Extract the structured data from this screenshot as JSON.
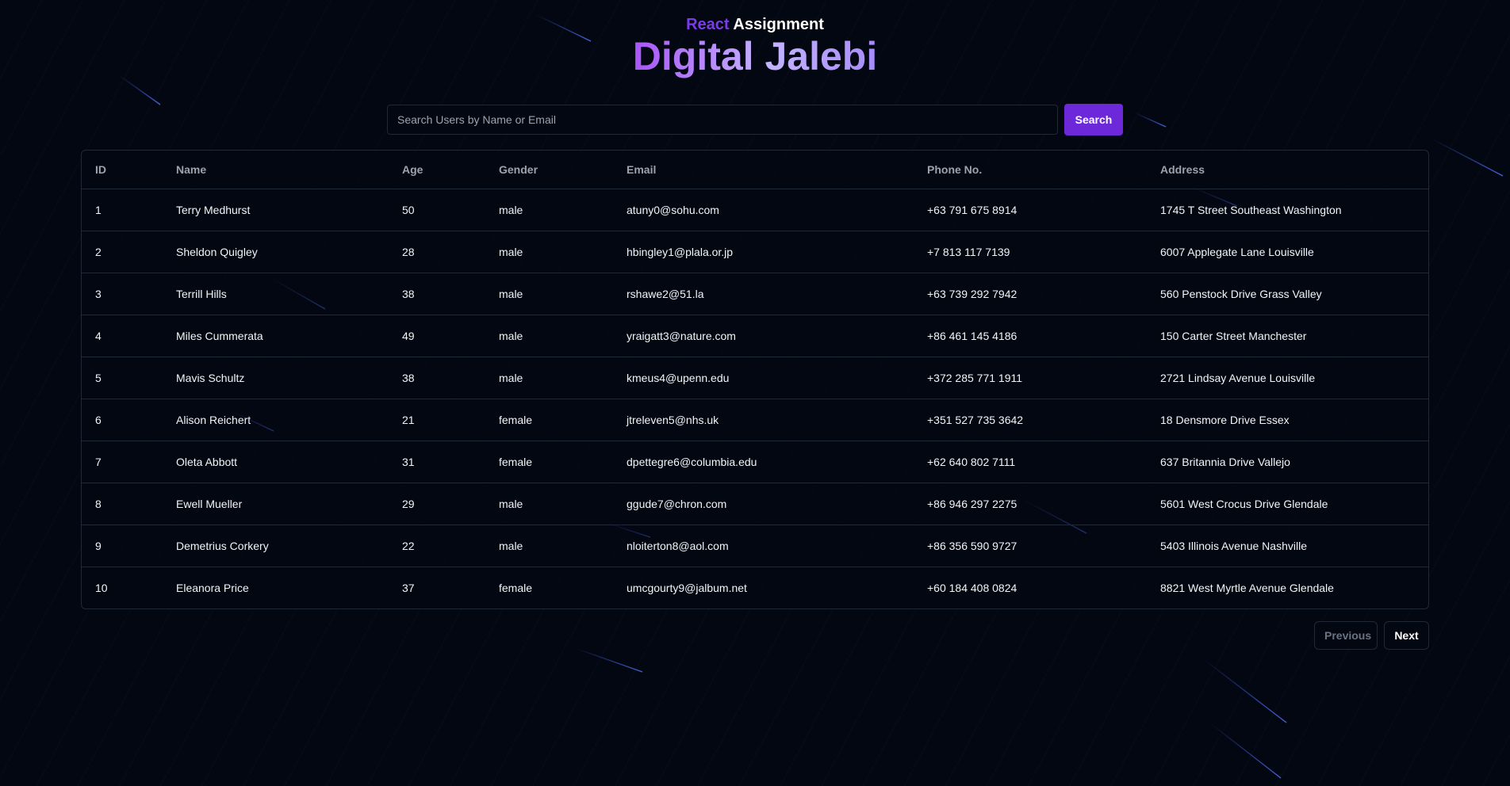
{
  "header": {
    "kicker_accent": "React",
    "kicker_rest": "Assignment",
    "title": "Digital Jalebi"
  },
  "search": {
    "placeholder": "Search Users by Name or Email",
    "value": "",
    "button_label": "Search"
  },
  "table": {
    "columns": [
      "ID",
      "Name",
      "Age",
      "Gender",
      "Email",
      "Phone No.",
      "Address"
    ],
    "rows": [
      [
        "1",
        "Terry Medhurst",
        "50",
        "male",
        "atuny0@sohu.com",
        "+63 791 675 8914",
        "1745 T Street Southeast Washington"
      ],
      [
        "2",
        "Sheldon Quigley",
        "28",
        "male",
        "hbingley1@plala.or.jp",
        "+7 813 117 7139",
        "6007 Applegate Lane Louisville"
      ],
      [
        "3",
        "Terrill Hills",
        "38",
        "male",
        "rshawe2@51.la",
        "+63 739 292 7942",
        "560 Penstock Drive Grass Valley"
      ],
      [
        "4",
        "Miles Cummerata",
        "49",
        "male",
        "yraigatt3@nature.com",
        "+86 461 145 4186",
        "150 Carter Street Manchester"
      ],
      [
        "5",
        "Mavis Schultz",
        "38",
        "male",
        "kmeus4@upenn.edu",
        "+372 285 771 1911",
        "2721 Lindsay Avenue Louisville"
      ],
      [
        "6",
        "Alison Reichert",
        "21",
        "female",
        "jtreleven5@nhs.uk",
        "+351 527 735 3642",
        "18 Densmore Drive Essex"
      ],
      [
        "7",
        "Oleta Abbott",
        "31",
        "female",
        "dpettegre6@columbia.edu",
        "+62 640 802 7111",
        "637 Britannia Drive Vallejo"
      ],
      [
        "8",
        "Ewell Mueller",
        "29",
        "male",
        "ggude7@chron.com",
        "+86 946 297 2275",
        "5601 West Crocus Drive Glendale"
      ],
      [
        "9",
        "Demetrius Corkery",
        "22",
        "male",
        "nloiterton8@aol.com",
        "+86 356 590 9727",
        "5403 Illinois Avenue Nashville"
      ],
      [
        "10",
        "Eleanora Price",
        "37",
        "female",
        "umcgourty9@jalbum.net",
        "+60 184 408 0824",
        "8821 West Myrtle Avenue Glendale"
      ]
    ]
  },
  "pagination": {
    "previous_label": "Previous",
    "next_label": "Next"
  },
  "colors": {
    "background": "#030712",
    "accent": "#6d28d9",
    "border": "#1f2937"
  }
}
